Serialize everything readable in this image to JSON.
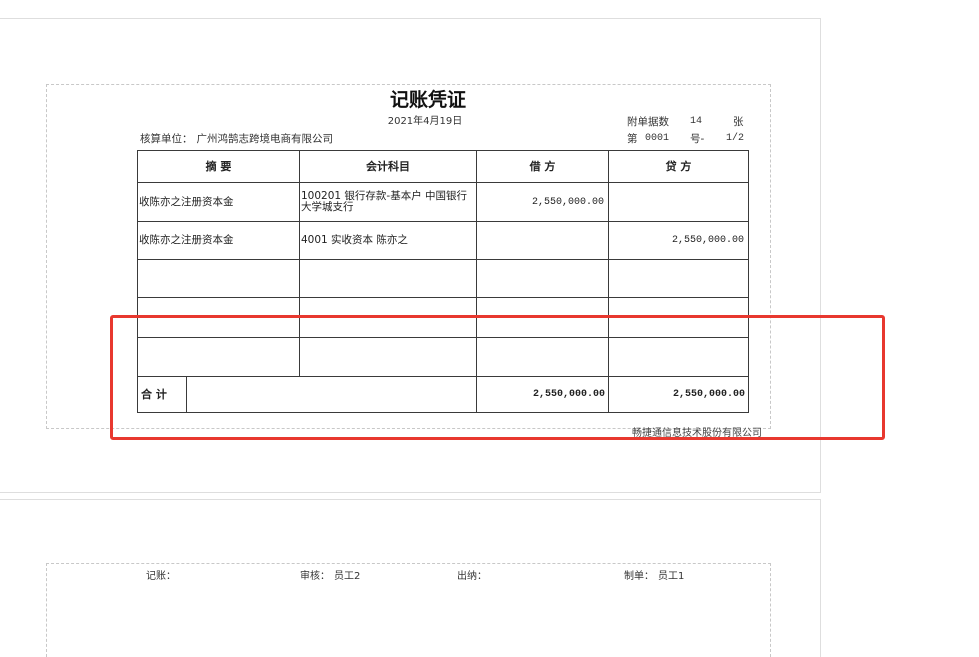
{
  "voucher": {
    "title": "记账凭证",
    "date": "2021年4月19日",
    "unit": {
      "label": "核算单位：",
      "name": "广州鸿鹄志跨境电商有限公司"
    },
    "attachments": {
      "label": "附单据数",
      "count": "14",
      "unit": "张"
    },
    "number": {
      "prefix": "第",
      "value": "0001",
      "suffix": "号-",
      "page": "1/2"
    },
    "columns": {
      "summary": "摘 要",
      "account": "会计科目",
      "debit": "借 方",
      "credit": "贷 方"
    },
    "entries": [
      {
        "summary": "收陈亦之注册资本金",
        "account": "100201 银行存款-基本户 中国银行大学城支行",
        "debit": "2,550,000.00"
      },
      {
        "summary": "收陈亦之注册资本金",
        "account": "4001 实收资本 陈亦之",
        "credit": "2,550,000.00"
      }
    ],
    "total": {
      "label": "合 计",
      "debit": "2,550,000.00",
      "credit": "2,550,000.00"
    },
    "footer_company": "畅捷通信息技术股份有限公司"
  },
  "signatures": {
    "bookkeeper": {
      "label": "记账："
    },
    "reviewer": {
      "label": "审核：",
      "name": "员工2"
    },
    "cashier": {
      "label": "出纳："
    },
    "preparer": {
      "label": "制单：",
      "name": "员工1"
    }
  },
  "colors": {
    "highlight_box": "#e8382f",
    "table_lines": "#3a3a3a",
    "page_border": "#dedede",
    "dashed_frame": "#c8c8c8",
    "text": "#2a2a2a"
  }
}
